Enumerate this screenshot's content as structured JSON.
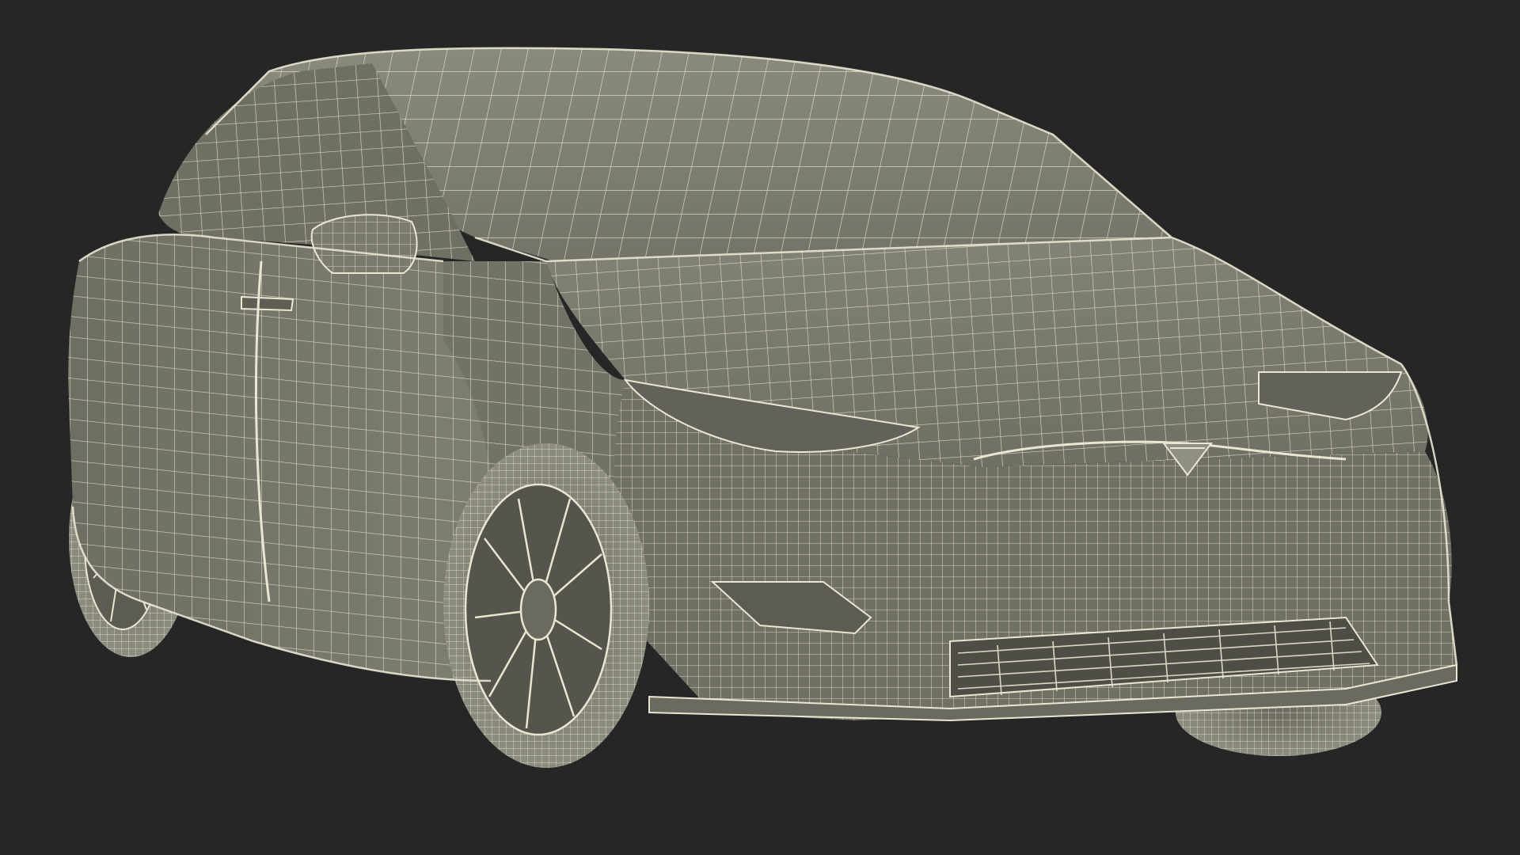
{
  "scene": {
    "subject": "car-wireframe",
    "colors": {
      "background": "#262626",
      "body_fill": "#7b7b6f",
      "body_shade": "#5f5f55",
      "body_dark": "#4a4a42",
      "wire": "#e9e6d2",
      "tire": "#8a8a7e"
    }
  }
}
